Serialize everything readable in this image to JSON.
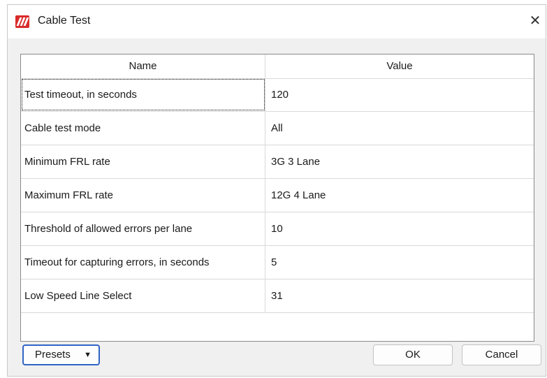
{
  "window": {
    "title": "Cable Test",
    "logo_icon": "app-logo-icon",
    "close_symbol": "✕",
    "accent_color": "#d92b2b"
  },
  "table": {
    "columns": [
      "Name",
      "Value"
    ],
    "rows": [
      {
        "name": "Test timeout, in seconds",
        "value": "120"
      },
      {
        "name": "Cable test mode",
        "value": "All"
      },
      {
        "name": "Minimum FRL rate",
        "value": "3G 3 Lane"
      },
      {
        "name": "Maximum FRL rate",
        "value": "12G 4 Lane"
      },
      {
        "name": "Threshold of allowed errors per lane",
        "value": "10"
      },
      {
        "name": "Timeout for capturing errors, in seconds",
        "value": "5"
      },
      {
        "name": "Low Speed Line Select",
        "value": "31"
      }
    ]
  },
  "buttons": {
    "presets": "Presets",
    "presets_caret": "▼",
    "ok": "OK",
    "cancel": "Cancel"
  }
}
